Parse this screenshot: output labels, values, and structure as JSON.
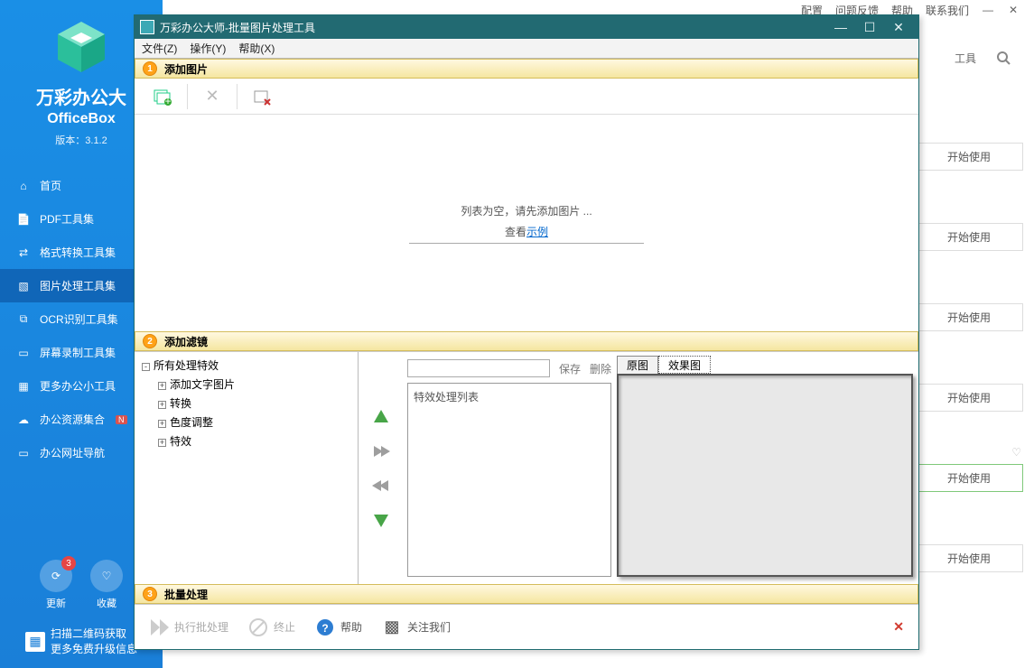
{
  "mainTop": {
    "config": "配置",
    "feedback": "问题反馈",
    "help": "帮助",
    "contact": "联系我们"
  },
  "brand": {
    "cn": "万彩办公大",
    "en": "OfficeBox",
    "version": "版本：3.1.2"
  },
  "nav": [
    {
      "label": "首页"
    },
    {
      "label": "PDF工具集"
    },
    {
      "label": "格式转换工具集"
    },
    {
      "label": "图片处理工具集"
    },
    {
      "label": "OCR识别工具集"
    },
    {
      "label": "屏幕录制工具集"
    },
    {
      "label": "更多办公小工具"
    },
    {
      "label": "办公资源集合"
    },
    {
      "label": "办公网址导航"
    }
  ],
  "navNew": "N",
  "bottom": {
    "update": "更新",
    "updateBadge": "3",
    "fav": "收藏",
    "qr1": "扫描二维码获取",
    "qr2": "更多免费升级信息"
  },
  "right": {
    "tools": "工具",
    "start": "开始使用"
  },
  "dialog": {
    "title": "万彩办公大师-批量图片处理工具",
    "menu": {
      "file": "文件(Z)",
      "ops": "操作(Y)",
      "help": "帮助(X)"
    },
    "step1": "添加图片",
    "step2": "添加滤镜",
    "step3": "批量处理",
    "empty": "列表为空，请先添加图片 ...",
    "view": "查看",
    "example": "示例",
    "treeRoot": "所有处理特效",
    "tree": [
      "添加文字图片",
      "转换",
      "色度调整",
      "特效"
    ],
    "save": "保存",
    "delete": "删除",
    "fxList": "特效处理列表",
    "tabOrig": "原图",
    "tabResult": "效果图",
    "run": "执行批处理",
    "stop": "终止",
    "helpBtn": "帮助",
    "follow": "关注我们"
  }
}
